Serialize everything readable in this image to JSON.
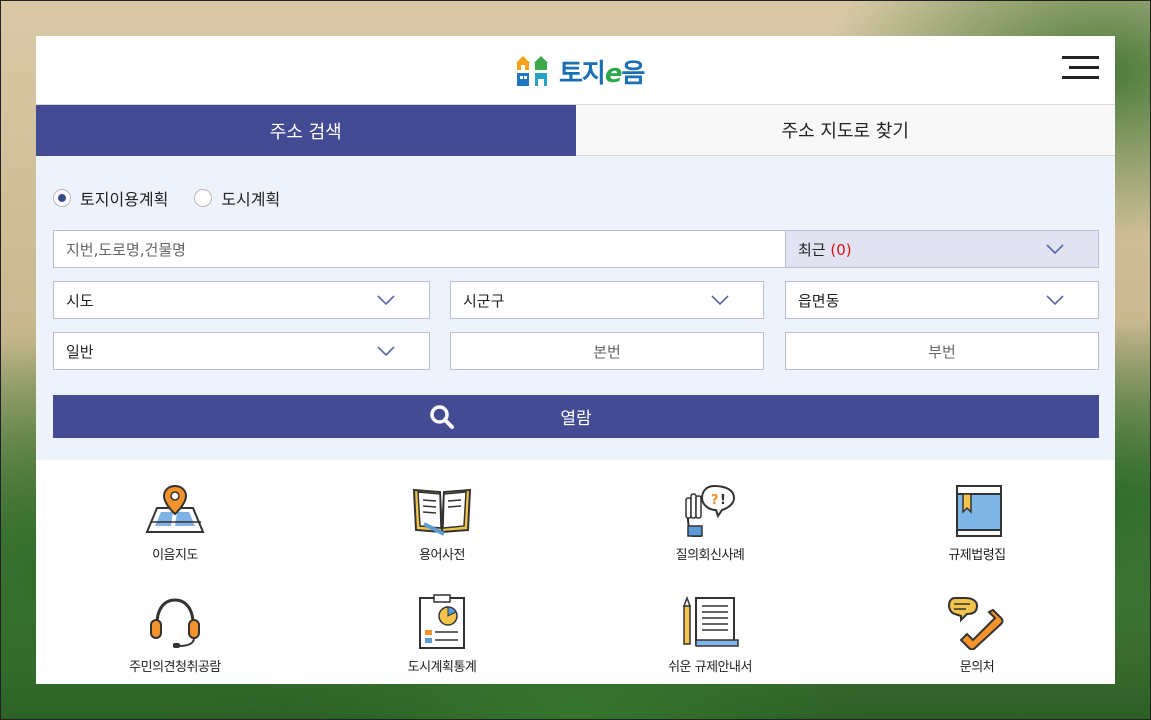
{
  "header": {
    "logo_text_a": "토지",
    "logo_text_e": "e",
    "logo_text_b": "음",
    "menu_icon": "hamburger-icon"
  },
  "tabs": [
    {
      "label": "주소 검색",
      "active": true
    },
    {
      "label": "주소 지도로 찾기",
      "active": false
    }
  ],
  "search": {
    "radio_options": [
      {
        "label": "토지이용계획",
        "selected": true
      },
      {
        "label": "도시계획",
        "selected": false
      }
    ],
    "address_placeholder": "지번,도로명,건물명",
    "recent_label": "최근",
    "recent_count": "(0)",
    "sido": "시도",
    "sigungu": "시군구",
    "eupmyeondong": "읍면동",
    "land_type": "일반",
    "main_number_placeholder": "본번",
    "sub_number_placeholder": "부번",
    "view_button": "열람"
  },
  "menu": [
    {
      "label": "이음지도",
      "icon": "map-pin-icon"
    },
    {
      "label": "용어사전",
      "icon": "open-book-icon"
    },
    {
      "label": "질의회신사례",
      "icon": "raised-hand-question-icon"
    },
    {
      "label": "규제법령집",
      "icon": "bookmark-book-icon"
    },
    {
      "label": "주민의견청취공람",
      "icon": "headset-icon"
    },
    {
      "label": "도시계획통계",
      "icon": "chart-board-icon"
    },
    {
      "label": "쉬운 규제안내서",
      "icon": "document-pencil-icon"
    },
    {
      "label": "문의처",
      "icon": "phone-chat-icon"
    }
  ],
  "colors": {
    "primary": "#434c93",
    "search_bg": "#eef3fb",
    "recent_bg": "#e1e3f3",
    "recent_count": "#dd1111"
  }
}
